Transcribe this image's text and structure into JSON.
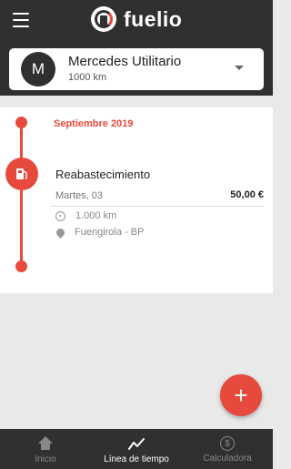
{
  "header": {
    "app_name": "fuelio"
  },
  "vehicle": {
    "avatar_letter": "M",
    "name": "Mercedes Utilitario",
    "odometer": "1000 km"
  },
  "timeline": {
    "month": "Septiembre 2019",
    "entries": [
      {
        "title": "Reabastecimiento",
        "date": "Martes, 03",
        "price": "50,00 €",
        "odometer": "1.000 km",
        "place": "Fuengirola - BP"
      }
    ]
  },
  "fab": {
    "label": "+"
  },
  "bottom_nav": {
    "items": [
      {
        "label": "Inicio",
        "icon": "home-icon"
      },
      {
        "label": "Línea de tiempo",
        "icon": "timeline-icon"
      },
      {
        "label": "Calculadora",
        "icon": "dollar-icon"
      }
    ],
    "active": "Línea de tiempo"
  },
  "colors": {
    "accent": "#e64a3c",
    "appbar": "#303030",
    "background": "#e9e9e9"
  }
}
